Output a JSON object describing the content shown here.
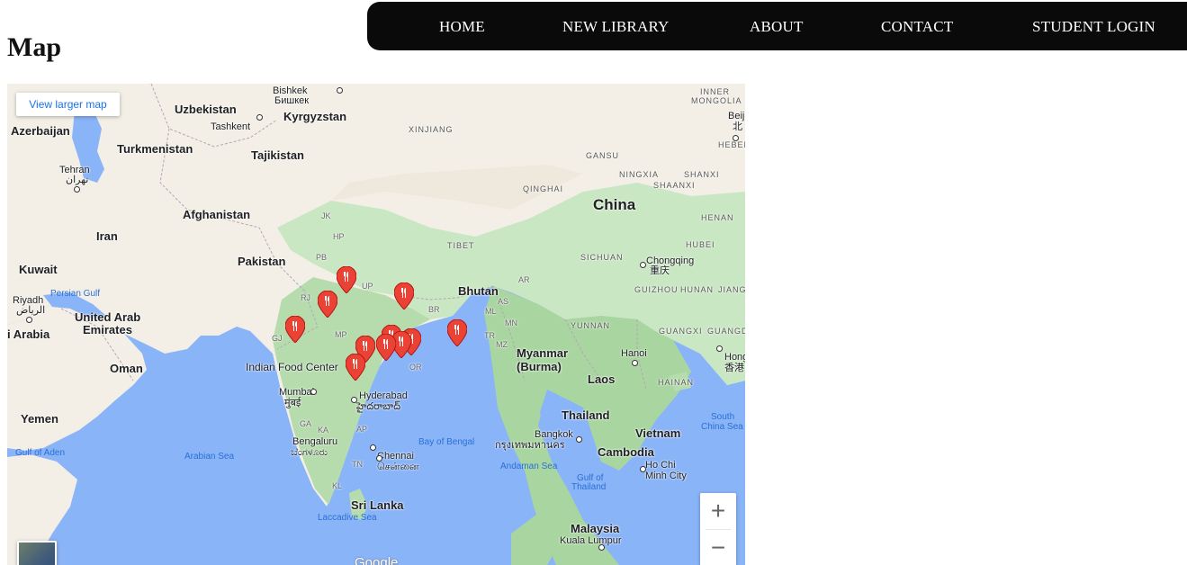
{
  "nav": {
    "items": [
      "HOME",
      "NEW LIBRARY",
      "ABOUT",
      "CONTACT",
      "STUDENT LOGIN"
    ]
  },
  "page": {
    "title": "Map"
  },
  "map": {
    "view_larger": "View larger map",
    "zoom_in": "+",
    "zoom_out": "−",
    "attribution": "Google",
    "marker_label": "Indian Food Center",
    "marker_icon": "restaurant-pin-icon",
    "marker_color": "#ea4335",
    "labels": {
      "countries": [
        "Uzbekistan",
        "Kyrgyzstan",
        "Azerbaijan",
        "Turkmenistan",
        "Tajikistan",
        "Afghanistan",
        "Iran",
        "Pakistan",
        "Kuwait",
        "United Arab",
        "Emirates",
        "Oman",
        "Yemen",
        "Bhutan",
        "Myanmar",
        "(Burma)",
        "Laos",
        "Thailand",
        "Vietnam",
        "Cambodia",
        "Sri Lanka",
        "Malaysia",
        "i Arabia"
      ],
      "big": [
        "China"
      ],
      "cities": [
        "Bishkek",
        "Бишкек",
        "Tashkent",
        "Tehran",
        "تهران",
        "Riyadh",
        "الرياض",
        "Chongqing",
        "重庆",
        "Hanoi",
        "Mumbai",
        "मुंबई",
        "Hyderabad",
        "హైదరాబాద్",
        "Bengaluru",
        "ಬೆಂಗಳೂರು",
        "Chennai",
        "சென்னை",
        "Bangkok",
        "กรุงเทพมหานคร",
        "Ho Chi",
        "Minh City",
        "Kuala Lumpur",
        "Beij",
        "北",
        "Hong",
        "香港"
      ],
      "regions": [
        "INNER",
        "MONGOLIA",
        "XINJIANG",
        "GANSU",
        "NINGXIA",
        "SHANXI",
        "SHAANXI",
        "HEBEI",
        "QINGHAI",
        "HENAN",
        "TIBET",
        "SICHUAN",
        "HUBEI",
        "GUIZHOU",
        "HUNAN",
        "JIANG",
        "YUNNAN",
        "GUANGXI",
        "GUANGDO",
        "HAINAN"
      ],
      "states": [
        "JK",
        "HP",
        "PB",
        "UP",
        "RJ",
        "BR",
        "AS",
        "ML",
        "MN",
        "TR",
        "MZ",
        "GJ",
        "MP",
        "OR",
        "GA",
        "KA",
        "AP",
        "TN",
        "KL",
        "AR"
      ],
      "waters": [
        "Persian Gulf",
        "Arabian Sea",
        "Bay of Bengal",
        "Andaman Sea",
        "Gulf of",
        "Thailand",
        "Laccadive Sea",
        "South",
        "China Sea",
        "Gulf of Aden"
      ]
    }
  }
}
